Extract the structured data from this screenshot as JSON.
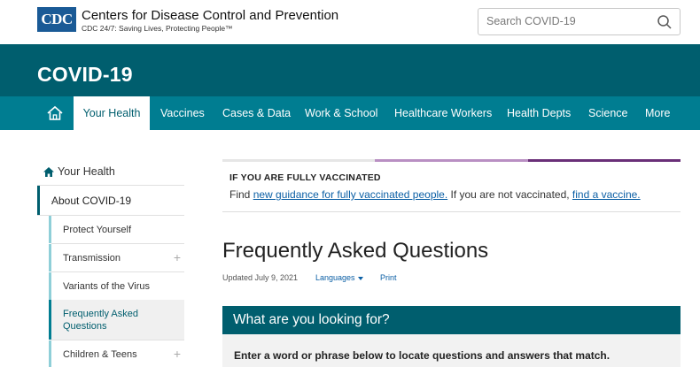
{
  "header": {
    "logo_text": "CDC",
    "org_name": "Centers for Disease Control and Prevention",
    "tagline": "CDC 24/7: Saving Lives, Protecting People™",
    "search_placeholder": "Search COVID-19",
    "search_icon": "search-icon"
  },
  "site_title": "COVID-19",
  "nav": {
    "home_icon": "home-icon",
    "tabs": [
      "Your Health",
      "Vaccines",
      "Cases & Data",
      "Work & School",
      "Healthcare Workers",
      "Health Depts",
      "Science",
      "More"
    ],
    "active_tab": "Your Health"
  },
  "sidebar": {
    "parent": "Your Health",
    "section": "About COVID-19",
    "section_toggle": "–",
    "items": [
      {
        "label": "Protect Yourself",
        "toggle": ""
      },
      {
        "label": "Transmission",
        "toggle": "+"
      },
      {
        "label": "Variants of the Virus",
        "toggle": ""
      },
      {
        "label": "Frequently Asked Questions",
        "toggle": ""
      },
      {
        "label": "Children & Teens",
        "toggle": "+"
      }
    ]
  },
  "alert": {
    "title": "IF YOU ARE FULLY VACCINATED",
    "text_before": "Find ",
    "link1": "new guidance for fully vaccinated people.",
    "text_middle": " If you are not vaccinated, ",
    "link2": "find a vaccine."
  },
  "main": {
    "title": "Frequently Asked Questions",
    "updated": "Updated July 9, 2021",
    "languages": "Languages",
    "print": "Print"
  },
  "search_panel": {
    "heading": "What are you looking for?",
    "instruction": "Enter a word or phrase below to locate questions and answers that match."
  },
  "colors": {
    "brand_dark": "#005e6e",
    "brand_nav": "#007d91",
    "link": "#0b5fa5",
    "alert_purple": "#6a2f78"
  }
}
